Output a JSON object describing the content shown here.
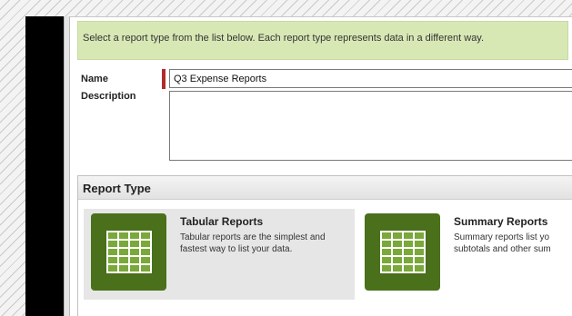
{
  "banner": {
    "text": "Select a report type from the list below. Each report type represents data in a different way."
  },
  "form": {
    "name_label": "Name",
    "name_value": "Q3 Expense Reports",
    "description_label": "Description",
    "description_value": ""
  },
  "report_type": {
    "title": "Report Type",
    "options": [
      {
        "title": "Tabular Reports",
        "description": "Tabular reports are the simplest and fastest way to list your data.",
        "icon": "table-grid-icon",
        "selected": true
      },
      {
        "title": "Summary Reports",
        "description": "Summary reports list yo subtotals and other sum",
        "icon": "table-grid-icon",
        "selected": false
      }
    ]
  },
  "colors": {
    "banner_bg": "#d8e8b5",
    "icon_bg": "#4a701b",
    "required_marker": "#b22b2b",
    "selected_card_bg": "#e6e6e6"
  }
}
